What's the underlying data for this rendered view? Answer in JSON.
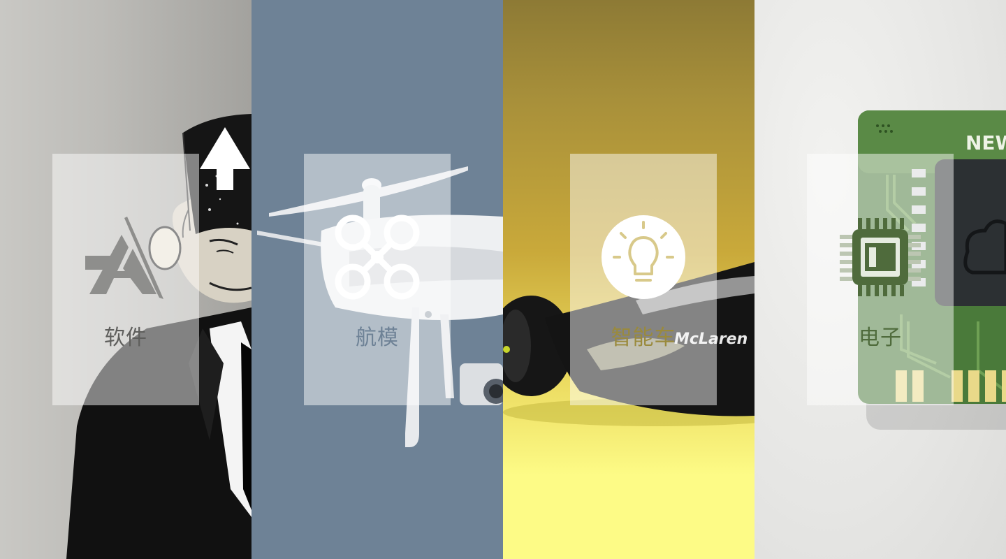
{
  "categories": [
    {
      "id": "software",
      "label": "软件",
      "icon": "app-store-icon",
      "label_color": "#5e5e5c"
    },
    {
      "id": "drone",
      "label": "航模",
      "icon": "drone-icon",
      "label_color": "#6e8296"
    },
    {
      "id": "smart-car",
      "label": "智能车",
      "icon": "lightbulb-icon",
      "label_color": "#9a8a3c"
    },
    {
      "id": "electronics",
      "label": "电子",
      "icon": "chip-icon",
      "label_color": "#4f6b3c"
    }
  ],
  "colors": {
    "software_bg": "#c0bfbb",
    "drone_bg": "#6e8296",
    "car_bg": "#c9a93a",
    "electronics_bg": "#e6e6e4",
    "chip_green": "#4a7a3a"
  },
  "decor": {
    "chip_text": "NEW",
    "car_brand": "McLaren"
  }
}
